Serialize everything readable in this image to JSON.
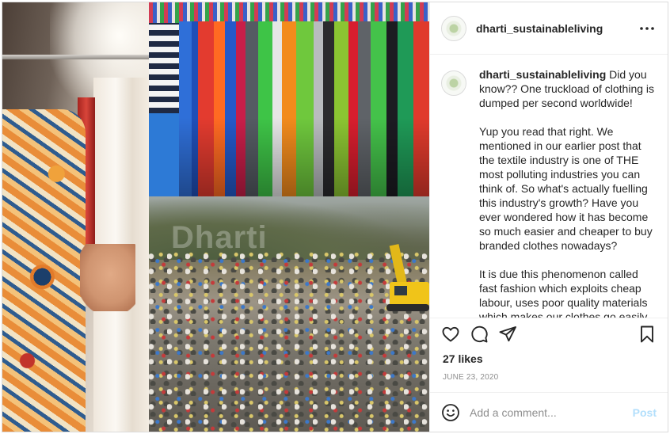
{
  "post": {
    "username": "dharti_sustainableliving",
    "media_watermark": "Dharti",
    "caption": {
      "first_line": "Did you know?? One truckload of clothing is dumped per second worldwide!",
      "paragraphs": [
        "Yup you read that right. We mentioned in our earlier post that the textile industry is one of THE most polluting industries you can think of. So what's actually fuelling this industry's growth? Have you ever wondered how it has become so much easier and cheaper to buy branded clothes nowadays?",
        "It is due this phenomenon called fast fashion which exploits cheap labour, uses poor quality materials which makes our clothes go easily out of shape or loose its color so you buy more frequently. It is designed to be"
      ]
    },
    "likes": "27 likes",
    "date": "JUNE 23, 2020",
    "comment_placeholder": "Add a comment...",
    "post_label": "Post"
  },
  "icons": {
    "more": "more-options-icon",
    "like": "heart-icon",
    "comment": "comment-icon",
    "share": "paper-plane-icon",
    "save": "bookmark-icon",
    "emoji": "smiley-icon"
  },
  "colors": {
    "text": "#262626",
    "muted": "#8e8e8e",
    "border": "#dbdbdb",
    "post_button": "#b2dffc"
  }
}
